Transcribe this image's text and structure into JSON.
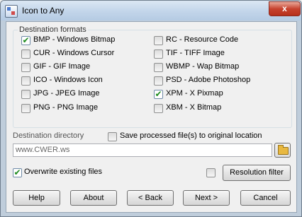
{
  "window": {
    "title": "Icon to Any",
    "close_glyph": "x"
  },
  "formats": {
    "group_label": "Destination formats",
    "left": [
      {
        "label": "BMP - Windows Bitmap",
        "checked": true
      },
      {
        "label": "CUR - Windows Cursor",
        "checked": false
      },
      {
        "label": "GIF - GIF Image",
        "checked": false
      },
      {
        "label": "ICO - Windows Icon",
        "checked": false
      },
      {
        "label": "JPG - JPEG Image",
        "checked": false
      },
      {
        "label": "PNG - PNG Image",
        "checked": false
      }
    ],
    "right": [
      {
        "label": "RC - Resource Code",
        "checked": false
      },
      {
        "label": "TIF - TIFF Image",
        "checked": false
      },
      {
        "label": "WBMP - Wap Bitmap",
        "checked": false
      },
      {
        "label": "PSD - Adobe Photoshop",
        "checked": false
      },
      {
        "label": "XPM - X Pixmap",
        "checked": true
      },
      {
        "label": "XBM - X Bitmap",
        "checked": false
      }
    ]
  },
  "destination": {
    "label": "Destination directory",
    "value": "www.CWER.ws",
    "save_original": {
      "label": "Save processed file(s) to original location",
      "checked": false
    }
  },
  "options": {
    "overwrite": {
      "label": "Overwrite existing files",
      "checked": true
    },
    "resolution_checkbox_checked": false,
    "resolution_filter_label": "Resolution filter"
  },
  "buttons": {
    "help": "Help",
    "about": "About",
    "back": "< Back",
    "next": "Next >",
    "cancel": "Cancel"
  },
  "icons": {
    "app": "app-icon",
    "folder": "folder-icon",
    "check": "✔"
  },
  "colors": {
    "title_bar": "#c2d5ea",
    "close_button": "#c7432f",
    "check_mark": "#1c8a1c"
  }
}
